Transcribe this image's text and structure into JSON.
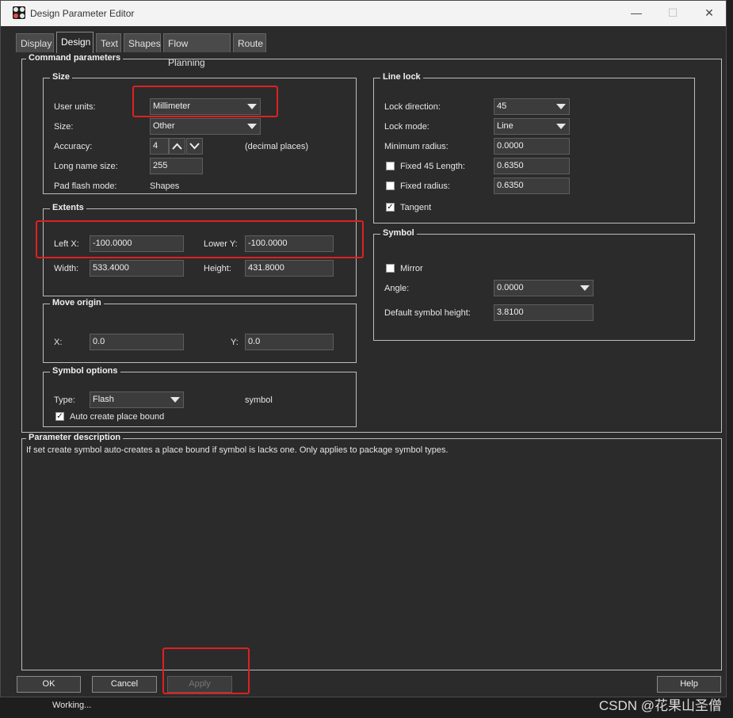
{
  "window": {
    "title": "Design Parameter Editor",
    "minimize": "—",
    "maximize": "☐",
    "close": "✕"
  },
  "tabs": [
    {
      "label": "Display"
    },
    {
      "label": "Design"
    },
    {
      "label": "Text"
    },
    {
      "label": "Shapes"
    },
    {
      "label": "Flow Planning"
    },
    {
      "label": "Route"
    }
  ],
  "active_tab": "Design",
  "command_parameters": {
    "label": "Command parameters",
    "size": {
      "label": "Size",
      "user_units_label": "User units:",
      "user_units_value": "Millimeter",
      "size_label": "Size:",
      "size_value": "Other",
      "accuracy_label": "Accuracy:",
      "accuracy_value": "4",
      "accuracy_suffix": "(decimal places)",
      "long_name_label": "Long name size:",
      "long_name_value": "255",
      "pad_flash_label": "Pad flash mode:",
      "pad_flash_value": "Shapes"
    },
    "extents": {
      "label": "Extents",
      "left_x_label": "Left X:",
      "left_x_value": "-100.0000",
      "lower_y_label": "Lower Y:",
      "lower_y_value": "-100.0000",
      "width_label": "Width:",
      "width_value": "533.4000",
      "height_label": "Height:",
      "height_value": "431.8000"
    },
    "move_origin": {
      "label": "Move origin",
      "x_label": "X:",
      "x_value": "0.0",
      "y_label": "Y:",
      "y_value": "0.0"
    },
    "symbol_options": {
      "label": "Symbol options",
      "type_label": "Type:",
      "type_value": "Flash",
      "type_suffix": "symbol",
      "auto_bound_label": "Auto create place bound",
      "auto_bound_checked": true
    },
    "line_lock": {
      "label": "Line lock",
      "direction_label": "Lock direction:",
      "direction_value": "45",
      "mode_label": "Lock mode:",
      "mode_value": "Line",
      "min_radius_label": "Minimum radius:",
      "min_radius_value": "0.0000",
      "fixed45_label": "Fixed 45 Length:",
      "fixed45_value": "0.6350",
      "fixed45_checked": false,
      "fixed_radius_label": "Fixed radius:",
      "fixed_radius_value": "0.6350",
      "fixed_radius_checked": false,
      "tangent_label": "Tangent",
      "tangent_checked": true
    },
    "symbol": {
      "label": "Symbol",
      "mirror_label": "Mirror",
      "mirror_checked": false,
      "angle_label": "Angle:",
      "angle_value": "0.0000",
      "default_height_label": "Default symbol height:",
      "default_height_value": "3.8100"
    }
  },
  "parameter_description": {
    "label": "Parameter description",
    "text": "If set create symbol auto-creates a place bound if symbol is lacks one. Only applies to package symbol types."
  },
  "buttons": {
    "ok": "OK",
    "cancel": "Cancel",
    "apply": "Apply",
    "help": "Help"
  },
  "status": {
    "text": "Working..."
  },
  "watermark": "CSDN @花果山圣僧",
  "colors": {
    "highlight_box": "#e02020",
    "panel_bg": "#2b2b2b",
    "title_bg": "#f3f3f3"
  }
}
